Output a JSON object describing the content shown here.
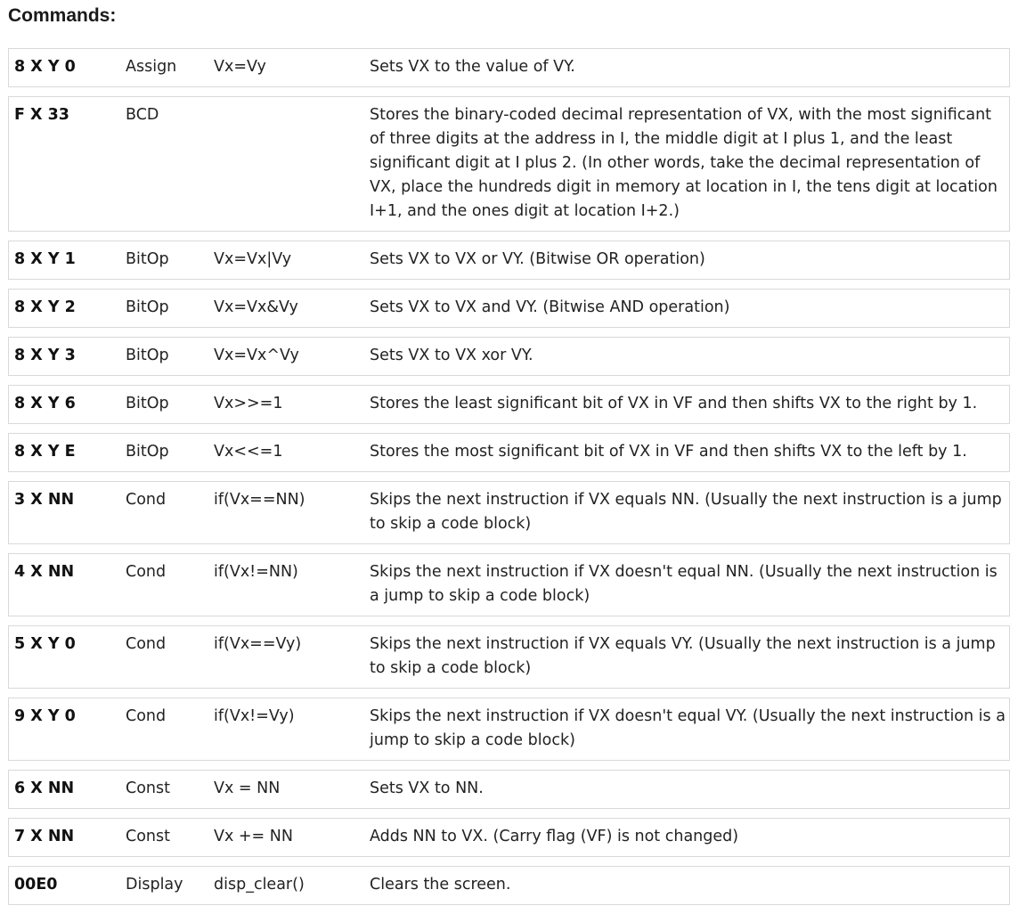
{
  "heading": "Commands:",
  "rows": [
    {
      "opcode": "8 X Y 0",
      "type": "Assign",
      "pseudo": "Vx=Vy",
      "explanation": "Sets VX to the value of VY."
    },
    {
      "opcode": "F X 33",
      "type": "BCD",
      "pseudo": "",
      "explanation": "Stores the binary-coded decimal representation of VX, with the most significant of three digits at the address in I, the middle digit at I plus 1, and the least significant digit at I plus 2. (In other words, take the decimal representation of VX, place the hundreds digit in memory at location in I, the tens digit at location I+1, and the ones digit at location I+2.)"
    },
    {
      "opcode": "8 X Y 1",
      "type": "BitOp",
      "pseudo": "Vx=Vx|Vy",
      "explanation": "Sets VX to VX or VY. (Bitwise OR operation)"
    },
    {
      "opcode": "8 X Y 2",
      "type": "BitOp",
      "pseudo": "Vx=Vx&Vy",
      "explanation": "Sets VX to VX and VY. (Bitwise AND operation)"
    },
    {
      "opcode": "8 X Y 3",
      "type": "BitOp",
      "pseudo": "Vx=Vx^Vy",
      "explanation": "Sets VX to VX xor VY."
    },
    {
      "opcode": "8 X Y 6",
      "type": "BitOp",
      "pseudo": "Vx>>=1",
      "explanation": "Stores the least significant bit of VX in VF and then shifts VX to the right by 1."
    },
    {
      "opcode": "8 X Y E",
      "type": "BitOp",
      "pseudo": "Vx<<=1",
      "explanation": "Stores the most significant bit of VX in VF and then shifts VX to the left by 1."
    },
    {
      "opcode": "3 X NN",
      "type": "Cond",
      "pseudo": "if(Vx==NN)",
      "explanation": "Skips the next instruction if VX equals NN. (Usually the next instruction is a jump to skip a code block)"
    },
    {
      "opcode": "4 X NN",
      "type": "Cond",
      "pseudo": "if(Vx!=NN)",
      "explanation": "Skips the next instruction if VX doesn't equal NN. (Usually the next instruction is a jump to skip a code block)"
    },
    {
      "opcode": "5 X Y 0",
      "type": "Cond",
      "pseudo": "if(Vx==Vy)",
      "explanation": "Skips the next instruction if VX equals VY. (Usually the next instruction is a jump to skip a code block)"
    },
    {
      "opcode": "9 X Y 0",
      "type": "Cond",
      "pseudo": "if(Vx!=Vy)",
      "explanation": "Skips the next instruction if VX doesn't equal VY. (Usually the next instruction is a jump to skip a code block)"
    },
    {
      "opcode": "6 X NN",
      "type": "Const",
      "pseudo": "Vx = NN",
      "explanation": "Sets VX to NN."
    },
    {
      "opcode": "7 X NN",
      "type": "Const",
      "pseudo": "Vx += NN",
      "explanation": "Adds NN to VX. (Carry flag (VF) is not changed)"
    },
    {
      "opcode": "00E0",
      "type": "Display",
      "pseudo": "disp_clear()",
      "explanation": "Clears the screen."
    }
  ]
}
